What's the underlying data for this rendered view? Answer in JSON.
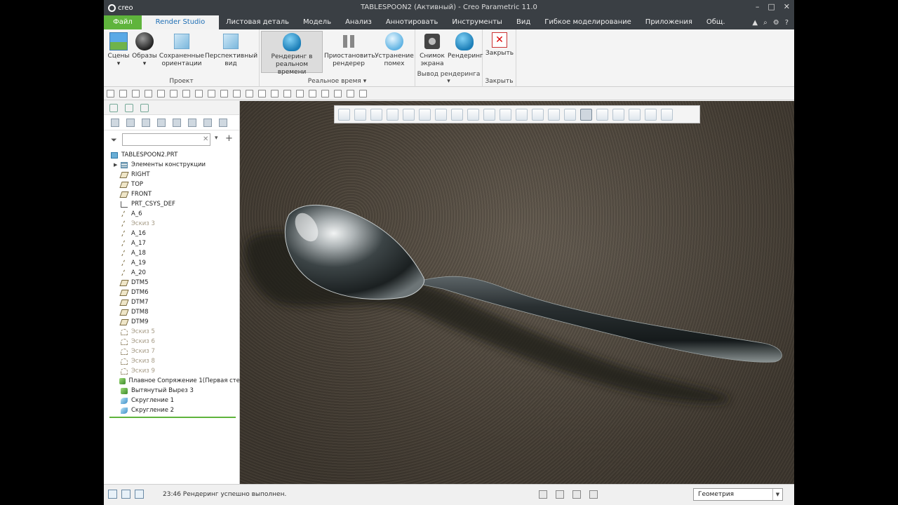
{
  "app": {
    "logo_text": "creo",
    "window_title": "TABLESPOON2 (Активный) - Creo Parametric 11.0",
    "window_controls": [
      "–",
      "□",
      "✕"
    ]
  },
  "tabs": [
    {
      "label": "Файл"
    },
    {
      "label": "Render Studio"
    },
    {
      "label": "Листовая деталь"
    },
    {
      "label": "Модель"
    },
    {
      "label": "Анализ"
    },
    {
      "label": "Аннотировать"
    },
    {
      "label": "Инструменты"
    },
    {
      "label": "Вид"
    },
    {
      "label": "Гибкое моделирование"
    },
    {
      "label": "Приложения"
    },
    {
      "label": "Общ."
    }
  ],
  "ribbon": {
    "groups": {
      "project": "Проект",
      "realtime": "Реальное время",
      "output": "Вывод рендеринга",
      "close": "Закрыть"
    },
    "buttons": {
      "scenes": "Сцены",
      "images": "Образы",
      "saved_orientations": "Сохраненные ориентации",
      "perspective": "Перспективный вид",
      "realtime_render": "Рендеринг в реальном времени",
      "pause_render": "Приостановить рендерер",
      "denoise": "Устранение помех",
      "snapshot": "Снимок экрана",
      "render": "Рендеринг",
      "close": "Закрыть"
    }
  },
  "model_tree": {
    "search_placeholder": "",
    "root": "TABLESPOON2.PRT",
    "items": [
      {
        "label": "Элементы конструкции",
        "icon": "tree-icon",
        "dim": false,
        "expand": true
      },
      {
        "label": "RIGHT",
        "icon": "plane-icon",
        "dim": false
      },
      {
        "label": "TOP",
        "icon": "plane-icon",
        "dim": false
      },
      {
        "label": "FRONT",
        "icon": "plane-icon",
        "dim": false
      },
      {
        "label": "PRT_CSYS_DEF",
        "icon": "csys-icon",
        "dim": false
      },
      {
        "label": "A_6",
        "icon": "axis-icon",
        "dim": false
      },
      {
        "label": "Эскиз 3",
        "icon": "axis-icon",
        "dim": true
      },
      {
        "label": "A_16",
        "icon": "axis-icon",
        "dim": false
      },
      {
        "label": "A_17",
        "icon": "axis-icon",
        "dim": false
      },
      {
        "label": "A_18",
        "icon": "axis-icon",
        "dim": false
      },
      {
        "label": "A_19",
        "icon": "axis-icon",
        "dim": false
      },
      {
        "label": "A_20",
        "icon": "axis-icon",
        "dim": false
      },
      {
        "label": "DTM5",
        "icon": "plane-icon",
        "dim": false
      },
      {
        "label": "DTM6",
        "icon": "plane-icon",
        "dim": false
      },
      {
        "label": "DTM7",
        "icon": "plane-icon",
        "dim": false
      },
      {
        "label": "DTM8",
        "icon": "plane-icon",
        "dim": false
      },
      {
        "label": "DTM9",
        "icon": "plane-icon",
        "dim": false
      },
      {
        "label": "Эскиз 5",
        "icon": "sketch-icon",
        "dim": true
      },
      {
        "label": "Эскиз 6",
        "icon": "sketch-icon",
        "dim": true
      },
      {
        "label": "Эскиз 7",
        "icon": "sketch-icon",
        "dim": true
      },
      {
        "label": "Эскиз 8",
        "icon": "sketch-icon",
        "dim": true
      },
      {
        "label": "Эскиз 9",
        "icon": "sketch-icon",
        "dim": true
      },
      {
        "label": "Плавное Сопряжение 1(Первая сте",
        "icon": "feature-icon",
        "dim": false
      },
      {
        "label": "Вытянутый Вырез 3",
        "icon": "feature-icon",
        "dim": false
      },
      {
        "label": "Скругление 1",
        "icon": "round-icon",
        "dim": false
      },
      {
        "label": "Скругление 2",
        "icon": "round-icon",
        "dim": false
      }
    ]
  },
  "status": {
    "message": "23:46 Рендеринг успешно выполнен.",
    "filter_value": "Геометрия"
  }
}
